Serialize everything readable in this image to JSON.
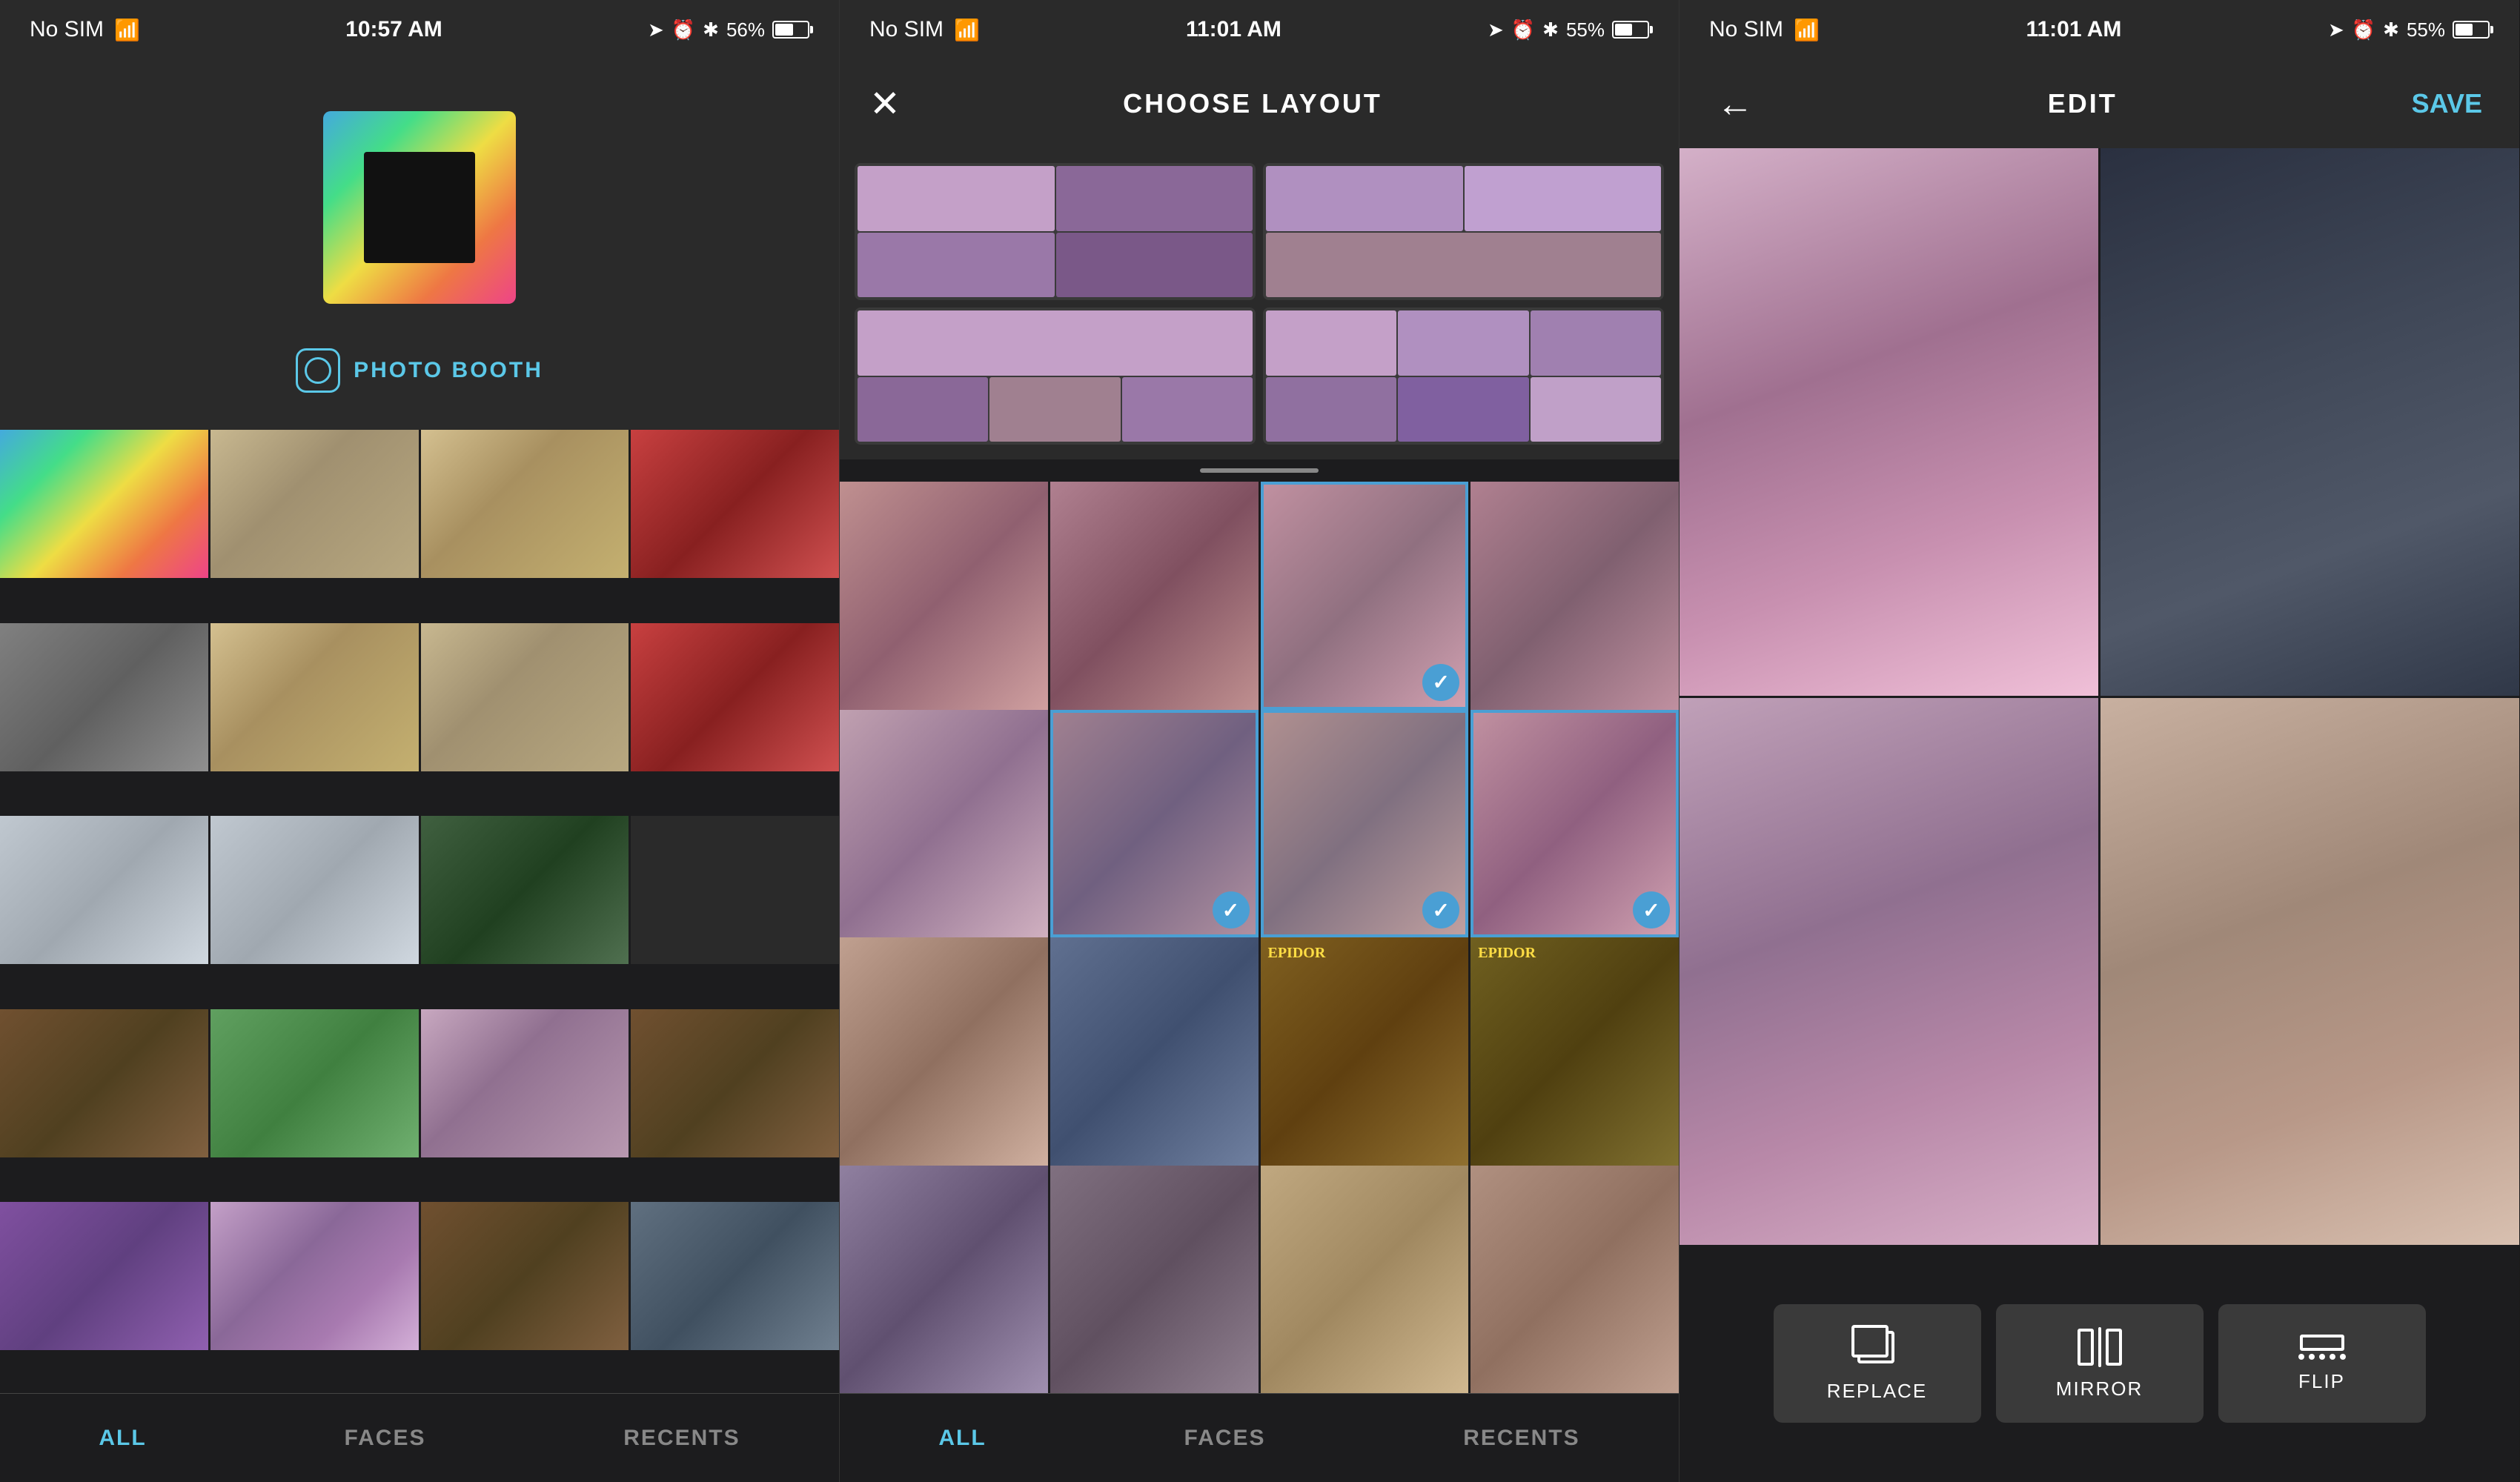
{
  "panels": [
    {
      "id": "panel1",
      "statusBar": {
        "left": "No SIM",
        "center": "10:57 AM",
        "battery": "56%"
      },
      "photobooth": {
        "label": "PHOTO BOOTH"
      },
      "tabs": [
        {
          "id": "all",
          "label": "ALL",
          "active": true
        },
        {
          "id": "faces",
          "label": "FACES",
          "active": false
        },
        {
          "id": "recents",
          "label": "RECENTS",
          "active": false
        }
      ]
    },
    {
      "id": "panel2",
      "statusBar": {
        "left": "No SIM",
        "center": "11:01 AM",
        "battery": "55%"
      },
      "nav": {
        "closeLabel": "✕",
        "title": "CHOOSE LAYOUT"
      },
      "tabs": [
        {
          "id": "all",
          "label": "ALL",
          "active": true
        },
        {
          "id": "faces",
          "label": "FACES",
          "active": false
        },
        {
          "id": "recents",
          "label": "RECENTS",
          "active": false
        }
      ]
    },
    {
      "id": "panel3",
      "statusBar": {
        "left": "No SIM",
        "center": "11:01 AM",
        "battery": "55%"
      },
      "nav": {
        "backLabel": "←",
        "title": "EDIT",
        "saveLabel": "SAVE"
      },
      "actions": [
        {
          "id": "replace",
          "label": "REPLACE",
          "icon": "replace-icon"
        },
        {
          "id": "mirror",
          "label": "MIRROR",
          "icon": "mirror-icon"
        },
        {
          "id": "flip",
          "label": "FLIP",
          "icon": "flip-icon"
        }
      ]
    }
  ]
}
